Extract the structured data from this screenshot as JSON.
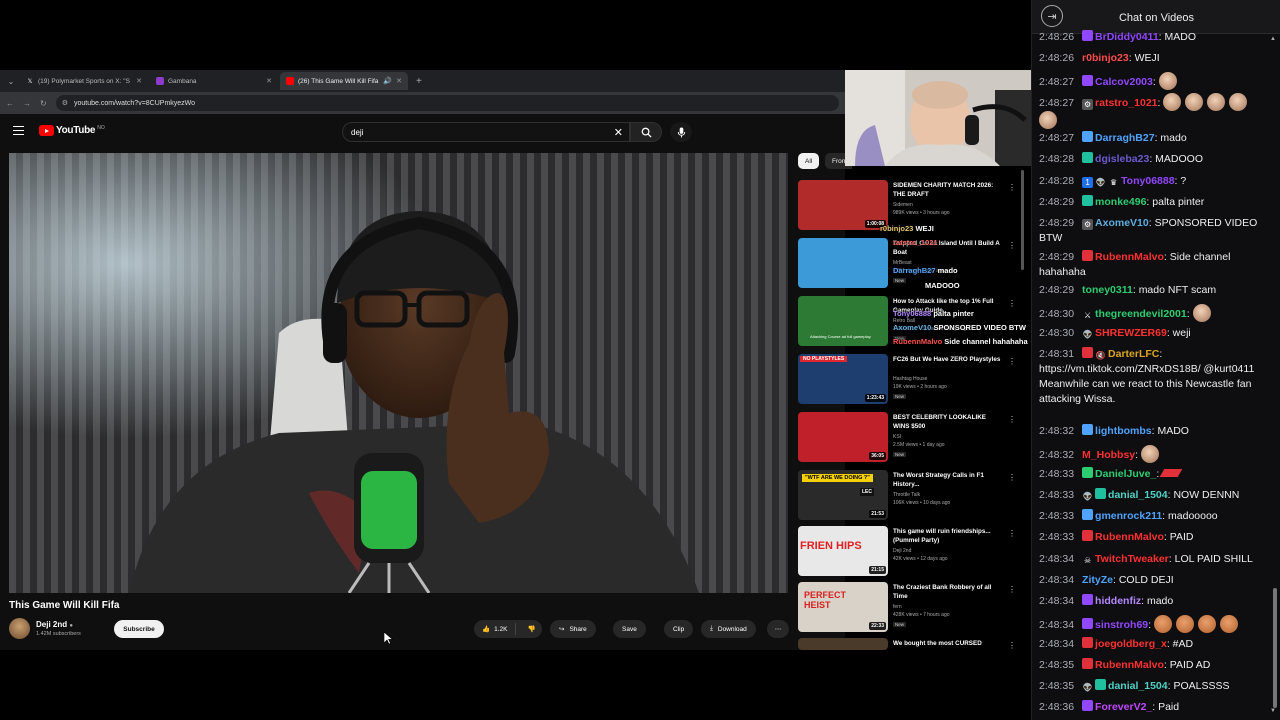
{
  "browser": {
    "tabs": [
      {
        "title": "(19) Polymarket Sports on X: \"S",
        "favicon": "x-icon",
        "active": false
      },
      {
        "title": "Gambana",
        "favicon": "gambana-icon",
        "active": false
      },
      {
        "title": "(26) This Game Will Kill Fifa",
        "favicon": "youtube-icon",
        "active": true
      }
    ],
    "url": "youtube.com/watch?v=8CUPmkyezWo"
  },
  "youtube": {
    "logo_text": "YouTube",
    "country_code": "NO",
    "search_value": "deji",
    "video": {
      "title": "This Game Will Kill Fifa",
      "channel": "Deji 2nd",
      "subscribers": "1.42M subscribers",
      "subscribe_label": "Subscribe",
      "likes": "1.2K",
      "share_label": "Share",
      "save_label": "Save",
      "clip_label": "Clip",
      "download_label": "Download"
    },
    "chips": [
      "All",
      "Fron"
    ],
    "recommendations": [
      {
        "title": "SIDEMEN CHARITY MATCH 2026: THE DRAFT",
        "channel": "Sidemen",
        "stats": "989K views • 3 hours ago",
        "duration": "1:00:08",
        "badge": "",
        "thumb_color": "#b22b2b"
      },
      {
        "title": "Trapped On an Island Until I Build A Boat",
        "channel": "MrBeast",
        "stats": "4.8M views • 1 day ago",
        "duration": "",
        "badge": "New",
        "thumb_color": "#3c9ad8"
      },
      {
        "title": "How to Attack like the top 1% Full Gameplay Guide",
        "channel": "Retro Ball",
        "stats": "1.7K views • Streamed 4 days ago",
        "duration": "",
        "badge": "New",
        "thumb_color": "#2c7a34"
      },
      {
        "title": "FC26 But We Have ZERO Playstyles",
        "channel": "Hashtag House",
        "stats": "19K views • 2 hours ago",
        "duration": "1:23:43",
        "badge": "New",
        "thumb_color": "#1d3e6e"
      },
      {
        "title": "BEST CELEBRITY LOOKALIKE WINS $500",
        "channel": "KSI",
        "stats": "2.5M views • 1 day ago",
        "duration": "36:05",
        "badge": "New",
        "thumb_color": "#c0202a"
      },
      {
        "title": "The Worst Strategy Calls in F1 History...",
        "channel": "Throttle Talk",
        "stats": "106K views • 10 days ago",
        "duration": "21:53",
        "badge": "",
        "thumb_color": "#2a2a2a"
      },
      {
        "title": "This game will ruin friendships... (Pummel Party)",
        "channel": "Deji 2nd",
        "stats": "42K views • 12 days ago",
        "duration": "21:15",
        "badge": "",
        "thumb_color": "#e8e8e8"
      },
      {
        "title": "The Craziest Bank Robbery of all Time",
        "channel": "fern",
        "stats": "428K views • 7 hours ago",
        "duration": "22:33",
        "badge": "New",
        "thumb_color": "#d8d2c8"
      },
      {
        "title": "We bought the most CURSED",
        "channel": "",
        "stats": "",
        "duration": "",
        "badge": "",
        "thumb_color": "#4a3a2a"
      }
    ],
    "thumb_texts": {
      "rec4_banner": "NO PLAYSTYLES",
      "rec6_banner": "\"WTF ARE WE DOING ?\"",
      "rec6_tag": "LEC",
      "rec7_text": "FRIEN  HIPS",
      "rec8_text": "PERFECT HEIST",
      "rec3_caption": "Attacking Course ad full gameplay"
    }
  },
  "overlay": [
    {
      "user": "r0binjo23",
      "text": "WEJI"
    },
    {
      "user": "ratstro_1021",
      "text": ""
    },
    {
      "user": "DarraghB27",
      "text": "mado"
    },
    {
      "user": "",
      "text": "MADOOO"
    },
    {
      "user": "Tony06888",
      "text": "palta pinter"
    },
    {
      "user": "AxomeV10",
      "text": "SPONSORED VIDEO BTW"
    },
    {
      "user": "RubennMalvo",
      "text": "Side channel hahahaha"
    }
  ],
  "chat": {
    "title": "Chat on Videos",
    "messages": [
      {
        "time": "2:48:26",
        "user": "BrDiddy0411",
        "color": "#9147ff",
        "badges": [
          "purple"
        ],
        "text": "MADO",
        "emotes": 0
      },
      {
        "time": "2:48:26",
        "user": "r0binjo23",
        "color": "#ff4b4b",
        "badges": [],
        "text": "WEJI",
        "emotes": 0
      },
      {
        "time": "2:48:27",
        "user": "Calcov2003",
        "color": "#9147ff",
        "badges": [
          "purple"
        ],
        "text": "",
        "emotes": 1
      },
      {
        "time": "2:48:27",
        "user": "ratstro_1021",
        "color": "#ff3030",
        "badges": [
          "robot"
        ],
        "text": "",
        "emotes": 5
      },
      {
        "time": "2:48:27",
        "user": "DarraghB27",
        "color": "#4fa3ff",
        "badges": [
          "blue"
        ],
        "text": "mado",
        "emotes": 0
      },
      {
        "time": "2:48:28",
        "user": "dgisleba23",
        "color": "#6a5acd",
        "badges": [
          "teal"
        ],
        "text": "MADOOO",
        "emotes": 0
      },
      {
        "time": "2:48:28",
        "user": "Tony06888",
        "color": "#9147ff",
        "badges": [
          "one",
          "alien",
          "crown"
        ],
        "text": "?",
        "emotes": 0
      },
      {
        "time": "2:48:29",
        "user": "monke496",
        "color": "#2ecc71",
        "badges": [
          "teal"
        ],
        "text": "palta pinter",
        "emotes": 0
      },
      {
        "time": "2:48:29",
        "user": "AxomeV10",
        "color": "#5dade2",
        "badges": [
          "robot"
        ],
        "text": "SPONSORED VIDEO BTW",
        "emotes": 0
      },
      {
        "time": "2:48:29",
        "user": "RubennMalvo",
        "color": "#ff3030",
        "badges": [
          "red"
        ],
        "text": "Side channel hahahaha",
        "emotes": 0
      },
      {
        "time": "2:48:29",
        "user": "toney0311",
        "color": "#2ecc71",
        "badges": [],
        "text": "mado NFT scam",
        "emotes": 0
      },
      {
        "time": "2:48:30",
        "user": "thegreendevil2001",
        "color": "#2ecc71",
        "badges": [
          "sword"
        ],
        "text": "",
        "emotes": 1
      },
      {
        "time": "2:48:30",
        "user": "SHREWZER69",
        "color": "#ff3030",
        "badges": [
          "alien"
        ],
        "text": "weji",
        "emotes": 0
      },
      {
        "time": "2:48:31",
        "user": "DarterLFC",
        "color": "#daa520",
        "badges": [
          "red-round",
          "mute"
        ],
        "text": "https://vm.tiktok.com/ZNRxDS18B/ @kurt0411 Meanwhile can we react to this Newcastle fan attacking Wissa.",
        "emotes": 0
      },
      {
        "time": "2:48:32",
        "user": "lightbombs",
        "color": "#4fa3ff",
        "badges": [
          "blue"
        ],
        "text": "MADO",
        "emotes": 0
      },
      {
        "time": "2:48:32",
        "user": "M_Hobbsy",
        "color": "#ff3030",
        "badges": [],
        "text": "",
        "emotes": 1
      },
      {
        "time": "2:48:33",
        "user": "DanielJuve_",
        "color": "#2ecc71",
        "badges": [
          "green"
        ],
        "text": "",
        "emotes": 0
      },
      {
        "time": "2:48:33",
        "user": "danial_1504",
        "color": "#4fd1c5",
        "badges": [
          "alien",
          "teal"
        ],
        "text": "NOW DENNN",
        "emotes": 0
      },
      {
        "time": "2:48:33",
        "user": "gmenrock211",
        "color": "#4fa3ff",
        "badges": [
          "blue"
        ],
        "text": "madooooo",
        "emotes": 0
      },
      {
        "time": "2:48:33",
        "user": "RubennMalvo",
        "color": "#ff3030",
        "badges": [
          "red"
        ],
        "text": "PAID",
        "emotes": 0
      },
      {
        "time": "2:48:34",
        "user": "TwitchTweaker",
        "color": "#ff3030",
        "badges": [
          "skull"
        ],
        "text": "LOL PAID SHILL",
        "emotes": 0
      },
      {
        "time": "2:48:34",
        "user": "ZityZe",
        "color": "#4fa3ff",
        "badges": [],
        "text": "COLD DEJI",
        "emotes": 0
      },
      {
        "time": "2:48:34",
        "user": "hiddenfiz",
        "color": "#b388ff",
        "badges": [
          "purple"
        ],
        "text": "mado",
        "emotes": 0
      },
      {
        "time": "2:48:34",
        "user": "sinstroh69",
        "color": "#9147ff",
        "badges": [
          "purple"
        ],
        "text": "",
        "emotes": 4
      },
      {
        "time": "2:48:34",
        "user": "joegoldberg_x",
        "color": "#ff3030",
        "badges": [
          "red"
        ],
        "text": "#AD",
        "emotes": 0
      },
      {
        "time": "2:48:35",
        "user": "RubennMalvo",
        "color": "#ff3030",
        "badges": [
          "red"
        ],
        "text": "PAID AD",
        "emotes": 0
      },
      {
        "time": "2:48:35",
        "user": "danial_1504",
        "color": "#4fd1c5",
        "badges": [
          "alien",
          "teal"
        ],
        "text": "POALSSSS",
        "emotes": 0
      },
      {
        "time": "2:48:36",
        "user": "ForeverV2_",
        "color": "#c048ff",
        "badges": [
          "purple"
        ],
        "text": "Paid",
        "emotes": 0
      }
    ]
  }
}
